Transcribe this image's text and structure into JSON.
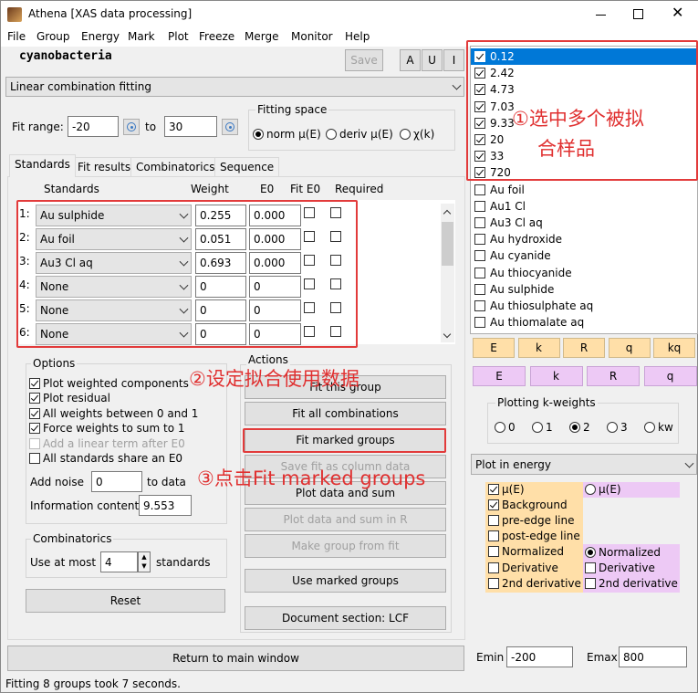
{
  "window": {
    "title": "Athena [XAS data processing]",
    "status": "Fitting 8 groups took 7 seconds."
  },
  "menu": [
    "File",
    "Group",
    "Energy",
    "Mark",
    "Plot",
    "Freeze",
    "Merge",
    "Monitor",
    "Help"
  ],
  "group_name": "cyanobacteria",
  "toolbar": {
    "save": "Save",
    "a": "A",
    "u": "U",
    "i": "I"
  },
  "analysis_select": "Linear combination fitting",
  "fit_range": {
    "label": "Fit range:",
    "from": "-20",
    "to_label": "to",
    "to": "30"
  },
  "fitting_space": {
    "title": "Fitting space",
    "options": [
      "norm μ(E)",
      "deriv μ(E)",
      "χ(k)"
    ],
    "selected": 0
  },
  "tabs": [
    "Standards",
    "Fit results",
    "Combinatorics",
    "Sequence"
  ],
  "standards_table": {
    "headers": [
      "Standards",
      "Weight",
      "E0",
      "Fit E0",
      "Required"
    ],
    "rows": [
      {
        "num": "1:",
        "std": "Au sulphide",
        "weight": "0.255",
        "e0": "0.000"
      },
      {
        "num": "2:",
        "std": "Au foil",
        "weight": "0.051",
        "e0": "0.000"
      },
      {
        "num": "3:",
        "std": "Au3 Cl aq",
        "weight": "0.693",
        "e0": "0.000"
      },
      {
        "num": "4:",
        "std": "None",
        "weight": "0",
        "e0": "0"
      },
      {
        "num": "5:",
        "std": "None",
        "weight": "0",
        "e0": "0"
      },
      {
        "num": "6:",
        "std": "None",
        "weight": "0",
        "e0": "0"
      }
    ]
  },
  "options": {
    "title": "Options",
    "checks": [
      {
        "label": "Plot weighted components",
        "on": true,
        "dis": false
      },
      {
        "label": "Plot residual",
        "on": true,
        "dis": false
      },
      {
        "label": "All weights between 0 and 1",
        "on": true,
        "dis": false
      },
      {
        "label": "Force weights to sum to 1",
        "on": true,
        "dis": false
      },
      {
        "label": "Add a linear term after E0",
        "on": false,
        "dis": true
      },
      {
        "label": "All standards share an E0",
        "on": false,
        "dis": false
      }
    ],
    "noise_label": "Add noise",
    "noise": "0",
    "noise_suffix": "to data",
    "info_label": "Information content",
    "info": "9.553"
  },
  "combinatorics": {
    "title": "Combinatorics",
    "label": "Use at most",
    "value": "4",
    "suffix": "standards"
  },
  "reset": "Reset",
  "actions": {
    "title": "Actions",
    "buttons": [
      {
        "label": "Fit this group",
        "dis": false
      },
      {
        "label": "Fit all combinations",
        "dis": false
      },
      {
        "label": "Fit marked groups",
        "dis": false
      },
      {
        "label": "Save fit as column data",
        "dis": true
      },
      {
        "label": "Plot data and sum",
        "dis": false
      },
      {
        "label": "Plot data and sum in R",
        "dis": true
      },
      {
        "label": "Make group from fit",
        "dis": true
      },
      {
        "label": "Use marked groups",
        "dis": false
      },
      {
        "label": "Document section: LCF",
        "dis": false
      }
    ]
  },
  "return_btn": "Return to main window",
  "groups": [
    {
      "label": "0.12",
      "on": true
    },
    {
      "label": "2.42",
      "on": true
    },
    {
      "label": "4.73",
      "on": true
    },
    {
      "label": "7.03",
      "on": true
    },
    {
      "label": "9.33",
      "on": true
    },
    {
      "label": "20",
      "on": true
    },
    {
      "label": "33",
      "on": true
    },
    {
      "label": "720",
      "on": true
    },
    {
      "label": "Au foil",
      "on": false
    },
    {
      "label": "Au1 Cl",
      "on": false
    },
    {
      "label": "Au3 Cl aq",
      "on": false
    },
    {
      "label": "Au hydroxide",
      "on": false
    },
    {
      "label": "Au cyanide",
      "on": false
    },
    {
      "label": "Au thiocyanide",
      "on": false
    },
    {
      "label": "Au sulphide",
      "on": false
    },
    {
      "label": "Au thiosulphate aq",
      "on": false
    },
    {
      "label": "Au thiomalate aq",
      "on": false
    }
  ],
  "plot_row1": [
    "E",
    "k",
    "R",
    "q",
    "kq"
  ],
  "plot_row2": [
    "E",
    "k",
    "R",
    "q"
  ],
  "kweights": {
    "title": "Plotting k-weights",
    "options": [
      "0",
      "1",
      "2",
      "3",
      "kw"
    ],
    "selected": 2
  },
  "plot_space": "Plot in energy",
  "plot_left": [
    {
      "label": "μ(E)",
      "on": true
    },
    {
      "label": "Background",
      "on": true
    },
    {
      "label": "pre-edge line",
      "on": false
    },
    {
      "label": "post-edge line",
      "on": false
    },
    {
      "label": "Normalized",
      "on": false
    },
    {
      "label": "Derivative",
      "on": false
    },
    {
      "label": "2nd derivative",
      "on": false
    }
  ],
  "plot_right": {
    "radio1": "μ(E)",
    "radio2": "Normalized",
    "chk1": "Derivative",
    "chk2": "2nd derivative"
  },
  "emin": {
    "label": "Emin",
    "value": "-200"
  },
  "emax": {
    "label": "Emax",
    "value": "800"
  },
  "annotations": {
    "a1_line1": "①选中多个被拟",
    "a1_line2": "合样品",
    "a2": "②设定拟合使用数据",
    "a3": "③点击Fit marked groups"
  },
  "colors": {
    "selected": "#0078d7",
    "orange": "#ffdfa8",
    "pink": "#edc9f5",
    "red": "#e23b3b"
  }
}
